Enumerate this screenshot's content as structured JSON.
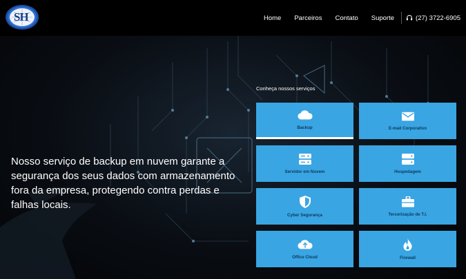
{
  "nav": {
    "items": [
      "Home",
      "Parceiros",
      "Contato",
      "Suporte"
    ],
    "phone": "(27) 3722-6905"
  },
  "logo": {
    "text": "SH"
  },
  "hero": {
    "text": "Nosso serviço de backup em nuvem garante a segurança dos seus dados com armazenamento fora da empresa, protegendo contra perdas e falhas locais."
  },
  "services": {
    "title": "Conheça nossos serviços",
    "items": [
      {
        "label": "Backup",
        "icon": "cloud-icon"
      },
      {
        "label": "E-mail Corporativo",
        "icon": "envelope-icon"
      },
      {
        "label": "Servidor em Nuvem",
        "icon": "server-icon"
      },
      {
        "label": "Hospedagem",
        "icon": "hosting-icon"
      },
      {
        "label": "Cyber Segurança",
        "icon": "shield-icon"
      },
      {
        "label": "Tercerização de T.I.",
        "icon": "briefcase-icon"
      },
      {
        "label": "Office Cloud",
        "icon": "cloud-upload-icon"
      },
      {
        "label": "Firewall",
        "icon": "fire-icon"
      }
    ]
  },
  "colors": {
    "card": "#3aa5e3",
    "card_text": "#0b3a5c",
    "navbar": "#000000"
  }
}
